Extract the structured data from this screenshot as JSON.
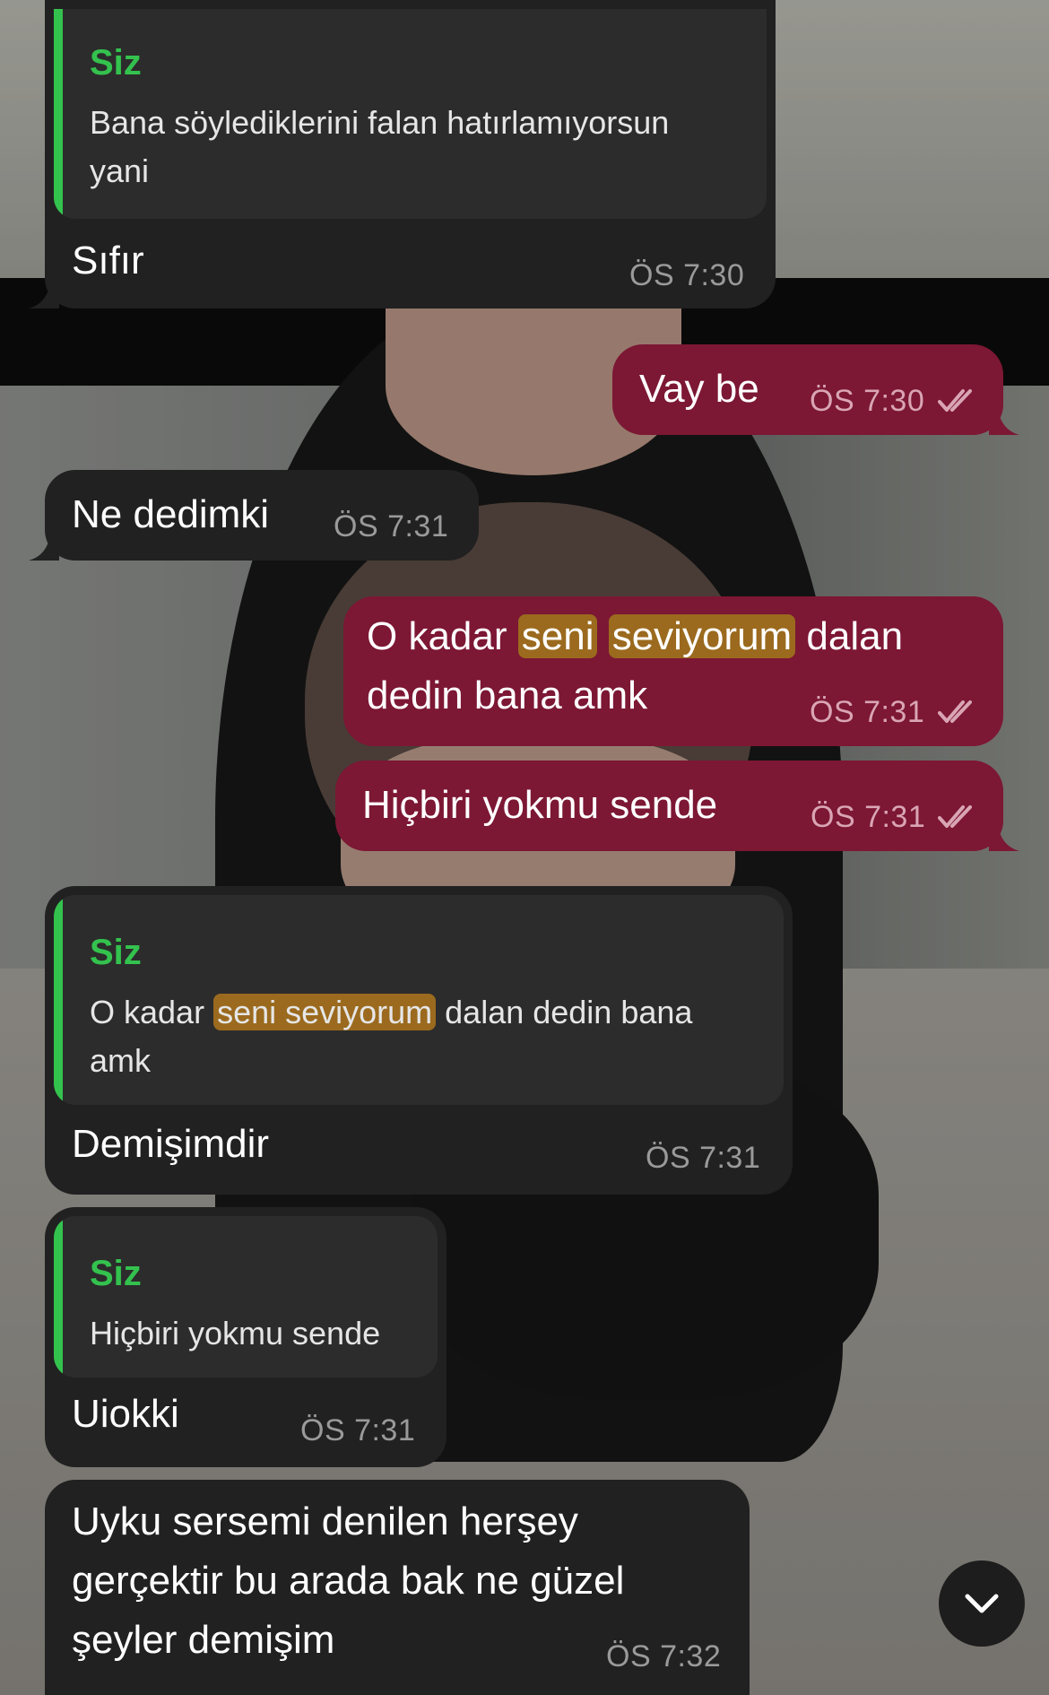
{
  "conversation": {
    "messages": [
      {
        "id": "m1",
        "direction": "incoming",
        "reply_to": {
          "sender": "Siz",
          "text_lines": [
            "Bana söylediklerini falan hatırlamıyorsun",
            "yani"
          ]
        },
        "text_lines": [
          "Sıfır"
        ],
        "time": "ÖS 7:30"
      },
      {
        "id": "m2",
        "direction": "outgoing",
        "text_lines": [
          "Vay be"
        ],
        "time": "ÖS 7:30",
        "status": "read"
      },
      {
        "id": "m3",
        "direction": "incoming",
        "text_lines": [
          "Ne dedimki"
        ],
        "time": "ÖS 7:31"
      },
      {
        "id": "m4",
        "direction": "outgoing",
        "text_parts": [
          {
            "text": "O kadar ",
            "highlight": false
          },
          {
            "text": "seni",
            "highlight": true
          },
          {
            "text": " ",
            "highlight": false
          },
          {
            "text": "seviyorum",
            "highlight": true
          },
          {
            "text": " dalan",
            "highlight": false
          }
        ],
        "text_line2": "dedin bana amk",
        "time": "ÖS 7:31",
        "status": "read"
      },
      {
        "id": "m5",
        "direction": "outgoing",
        "text_lines": [
          "Hiçbiri yokmu sende"
        ],
        "time": "ÖS 7:31",
        "status": "read"
      },
      {
        "id": "m6",
        "direction": "incoming",
        "reply_to": {
          "sender": "Siz",
          "text_parts": [
            {
              "text": "O kadar ",
              "highlight": false
            },
            {
              "text": "seni seviyorum",
              "highlight": true
            },
            {
              "text": " dalan dedin bana",
              "highlight": false
            }
          ],
          "text_line2": "amk"
        },
        "text_lines": [
          "Demişimdir"
        ],
        "time": "ÖS 7:31"
      },
      {
        "id": "m7",
        "direction": "incoming",
        "reply_to": {
          "sender": "Siz",
          "text_lines": [
            "Hiçbiri yokmu sende"
          ]
        },
        "text_lines": [
          "Uiokki"
        ],
        "time": "ÖS 7:31"
      },
      {
        "id": "m8",
        "direction": "incoming",
        "text_lines": [
          "Uyku sersemi denilen herşey",
          "gerçektir bu arada bak ne güzel",
          "şeyler demişim"
        ],
        "time": "ÖS 7:32"
      }
    ]
  },
  "colors": {
    "incoming_bubble": "#212121",
    "outgoing_bubble": "#7c1734",
    "quote_accent": "#34c24e",
    "search_highlight": "#9b6a1e"
  },
  "icons": {
    "read_receipt": "double-check-icon",
    "scroll_down": "chevron-down-icon"
  }
}
